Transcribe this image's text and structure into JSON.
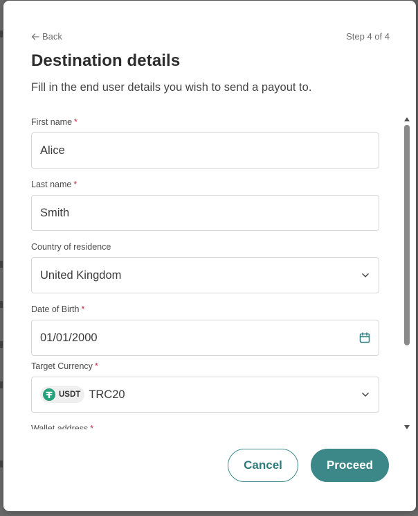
{
  "header": {
    "back_label": "Back",
    "step_label": "Step 4 of 4",
    "title": "Destination details",
    "subtitle": "Fill in the end user details you wish to send a payout to."
  },
  "form": {
    "first_name": {
      "label": "First name",
      "required_mark": "*",
      "value": "Alice"
    },
    "last_name": {
      "label": "Last name",
      "required_mark": "*",
      "value": "Smith"
    },
    "country": {
      "label": "Country of residence",
      "value": "United Kingdom"
    },
    "dob": {
      "label": "Date of Birth",
      "required_mark": "*",
      "value": "01/01/2000"
    },
    "currency": {
      "label": "Target Currency",
      "required_mark": "*",
      "badge": "USDT",
      "value": "TRC20"
    },
    "wallet": {
      "label": "Wallet address",
      "required_mark": "*"
    }
  },
  "actions": {
    "cancel_label": "Cancel",
    "proceed_label": "Proceed"
  },
  "icons": {
    "back": "arrow-left-icon",
    "select": "chevron-down-icon",
    "date": "calendar-icon",
    "currency": "tether-icon"
  },
  "colors": {
    "accent": "#3c8788",
    "required": "#c0304a",
    "tether": "#26a17b"
  }
}
